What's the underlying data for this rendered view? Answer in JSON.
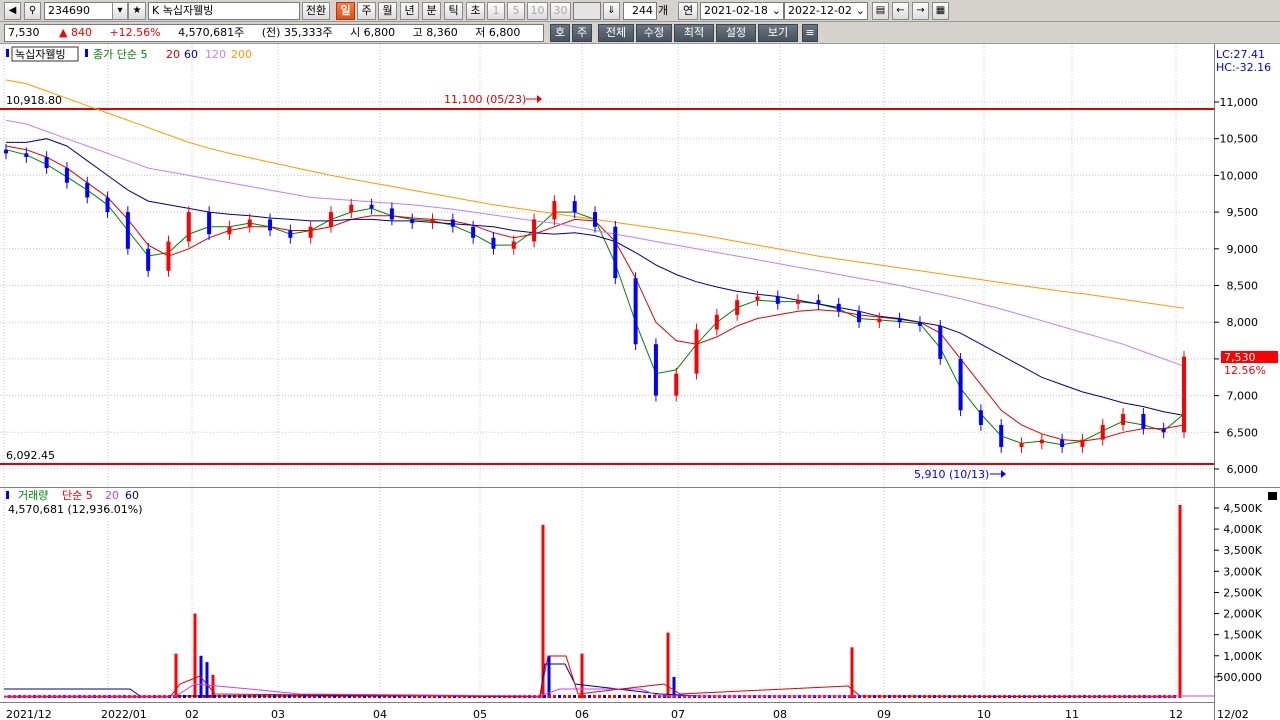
{
  "toolbar": {
    "code": "234690",
    "name_prefix": "K",
    "name": "녹십자웰빙",
    "convert_label": "전환",
    "periods": [
      "일",
      "주",
      "월",
      "년",
      "분",
      "틱",
      "초"
    ],
    "intervals": [
      "1",
      "5",
      "10",
      "30"
    ],
    "count": "244",
    "count_unit": "개",
    "year_label": "연",
    "date_from": "2021-02-18",
    "date_to": "2022-12-02"
  },
  "quote": {
    "price": "7,530",
    "change": "840",
    "change_pct": "+12.56%",
    "volume": "4,570,681주",
    "prev_volume": "(전) 35,333주",
    "open": "시 6,800",
    "high": "고 8,360",
    "low": "저 6,800",
    "buttons": [
      "호",
      "주",
      "전체",
      "수정",
      "최적",
      "설정",
      "보기"
    ]
  },
  "colors": {
    "up": "#ff0000",
    "down": "#0000ff",
    "ma5": "#008000",
    "ma20": "#e00000",
    "ma60": "#00008b",
    "ma120": "#c080ff",
    "ma200": "#ff9900",
    "price_tag": "#ff0000"
  },
  "price_panel": {
    "title": "녹십자웰빙",
    "ma_label": "종가 단순",
    "ma_periods": [
      "5",
      "20",
      "60",
      "120",
      "200"
    ],
    "lc": "LC:27.41",
    "hc": "HC:-32.16",
    "high_line_label": "10,918.80",
    "low_line_label": "6,092.45",
    "max_annotation": "11,100 (05/23)",
    "min_annotation": "5,910 (10/13)",
    "current_price_tag": "7,530",
    "current_pct": "12.56%"
  },
  "volume_panel": {
    "title": "거래량",
    "ma_label": "단순",
    "ma_periods": [
      "5",
      "20",
      "60"
    ],
    "current": "4,570,681 (12,936.01%)"
  },
  "chart_data": [
    {
      "type": "candlestick",
      "title": "녹십자웰빙",
      "ylim": [
        5800,
        11500
      ],
      "y_ticks": [
        6000,
        6500,
        7000,
        7500,
        8000,
        8500,
        9000,
        9500,
        10000,
        10500,
        11000
      ],
      "y_tick_labels": [
        "6,000",
        "6,500",
        "7,000",
        "7,500",
        "8,000",
        "8,500",
        "9,000",
        "9,500",
        "10,000",
        "10,500",
        "11,000"
      ],
      "x_labels": [
        "2021/12",
        "2022/01",
        "02",
        "03",
        "04",
        "05",
        "06",
        "07",
        "08",
        "09",
        "10",
        "11",
        "12",
        "12/02"
      ],
      "reference_lines": [
        10918.8,
        6092.45
      ],
      "series": [
        {
          "name": "종가",
          "values": [
            10300,
            10250,
            10100,
            9900,
            9700,
            9500,
            9000,
            8700,
            9100,
            9500,
            9200,
            9300,
            9400,
            9250,
            9150,
            9300,
            9500,
            9600,
            9550,
            9400,
            9350,
            9400,
            9300,
            9150,
            9000,
            9100,
            9400,
            9650,
            9500,
            9300,
            8600,
            7700,
            7000,
            7300,
            7900,
            8100,
            8300,
            8350,
            8250,
            8300,
            8250,
            8150,
            8000,
            8050,
            8000,
            7950,
            7500,
            6800,
            6600,
            6300,
            6350,
            6400,
            6300,
            6400,
            6600,
            6750,
            6550,
            6500,
            7530
          ]
        },
        {
          "name": "5",
          "values": [
            10350,
            10280,
            10150,
            9980,
            9800,
            9600,
            9250,
            8900,
            8950,
            9200,
            9300,
            9300,
            9350,
            9300,
            9200,
            9250,
            9400,
            9500,
            9550,
            9450,
            9400,
            9380,
            9320,
            9200,
            9050,
            9050,
            9250,
            9500,
            9500,
            9400,
            8800,
            8000,
            7300,
            7350,
            7700,
            8000,
            8200,
            8300,
            8280,
            8280,
            8250,
            8180,
            8050,
            8030,
            8010,
            7980,
            7650,
            7100,
            6750,
            6450,
            6350,
            6380,
            6330,
            6380,
            6520,
            6650,
            6600,
            6520,
            6750
          ]
        },
        {
          "name": "20",
          "values": [
            10400,
            10350,
            10250,
            10100,
            9900,
            9700,
            9400,
            9050,
            8900,
            9000,
            9150,
            9250,
            9300,
            9300,
            9250,
            9250,
            9300,
            9400,
            9450,
            9450,
            9420,
            9400,
            9380,
            9320,
            9220,
            9150,
            9200,
            9300,
            9400,
            9380,
            9100,
            8600,
            8000,
            7750,
            7700,
            7800,
            7950,
            8050,
            8100,
            8150,
            8170,
            8150,
            8100,
            8070,
            8040,
            8000,
            7850,
            7500,
            7150,
            6800,
            6600,
            6480,
            6400,
            6380,
            6420,
            6500,
            6550,
            6550,
            6600
          ]
        },
        {
          "name": "60",
          "values": [
            10450,
            10450,
            10500,
            10400,
            10200,
            10000,
            9800,
            9650,
            9600,
            9550,
            9500,
            9470,
            9450,
            9420,
            9400,
            9380,
            9380,
            9400,
            9400,
            9380,
            9380,
            9360,
            9340,
            9320,
            9300,
            9250,
            9220,
            9200,
            9220,
            9180,
            9100,
            8950,
            8780,
            8650,
            8550,
            8480,
            8420,
            8380,
            8350,
            8300,
            8250,
            8200,
            8150,
            8080,
            8050,
            8000,
            7950,
            7850,
            7700,
            7550,
            7400,
            7250,
            7150,
            7050,
            6980,
            6900,
            6850,
            6780,
            6730
          ]
        },
        {
          "name": "120",
          "values": [
            10750,
            10700,
            10600,
            10500,
            10400,
            10300,
            10200,
            10100,
            10050,
            10000,
            9950,
            9900,
            9850,
            9800,
            9750,
            9700,
            9680,
            9660,
            9640,
            9620,
            9600,
            9570,
            9540,
            9500,
            9460,
            9420,
            9380,
            9350,
            9300,
            9250,
            9200,
            9150,
            9100,
            9050,
            9000,
            8950,
            8900,
            8850,
            8800,
            8750,
            8700,
            8650,
            8600,
            8550,
            8500,
            8440,
            8380,
            8320,
            8250,
            8180,
            8100,
            8020,
            7940,
            7860,
            7780,
            7700,
            7600,
            7500,
            7400
          ]
        },
        {
          "name": "200",
          "values": [
            11300,
            11250,
            11150,
            11050,
            10950,
            10850,
            10750,
            10650,
            10550,
            10450,
            10370,
            10300,
            10240,
            10180,
            10120,
            10060,
            10000,
            9950,
            9900,
            9850,
            9800,
            9750,
            9700,
            9650,
            9600,
            9560,
            9520,
            9480,
            9440,
            9400,
            9360,
            9320,
            9280,
            9240,
            9200,
            9150,
            9100,
            9050,
            9000,
            8950,
            8900,
            8860,
            8820,
            8780,
            8740,
            8700,
            8660,
            8620,
            8580,
            8540,
            8500,
            8460,
            8420,
            8390,
            8350,
            8310,
            8270,
            8230,
            8190
          ]
        }
      ]
    },
    {
      "type": "bar",
      "title": "거래량",
      "ylim": [
        0,
        4800000
      ],
      "y_ticks": [
        500000,
        1000000,
        1500000,
        2000000,
        2500000,
        3000000,
        3500000,
        4000000,
        4500000
      ],
      "y_tick_labels": [
        "500,000",
        "1,000K",
        "1,500K",
        "2,000K",
        "2,500K",
        "3,000K",
        "3,500K",
        "4,000K",
        "4,500K"
      ],
      "spikes": [
        {
          "date": "2022-01",
          "value": 1050000,
          "color": "up"
        },
        {
          "date": "2022-02",
          "value": 2000000,
          "color": "up"
        },
        {
          "date": "2022-02",
          "value": 1000000,
          "color": "down"
        },
        {
          "date": "2022-02",
          "value": 850000,
          "color": "down"
        },
        {
          "date": "2022-02",
          "value": 550000,
          "color": "up"
        },
        {
          "date": "2022-05",
          "value": 4100000,
          "color": "up"
        },
        {
          "date": "2022-05",
          "value": 1000000,
          "color": "down"
        },
        {
          "date": "2022-06",
          "value": 1050000,
          "color": "up"
        },
        {
          "date": "2022-07",
          "value": 1550000,
          "color": "up"
        },
        {
          "date": "2022-07",
          "value": 500000,
          "color": "down"
        },
        {
          "date": "2022-08",
          "value": 1200000,
          "color": "up"
        },
        {
          "date": "2022-12",
          "value": 4570681,
          "color": "up"
        }
      ]
    }
  ]
}
